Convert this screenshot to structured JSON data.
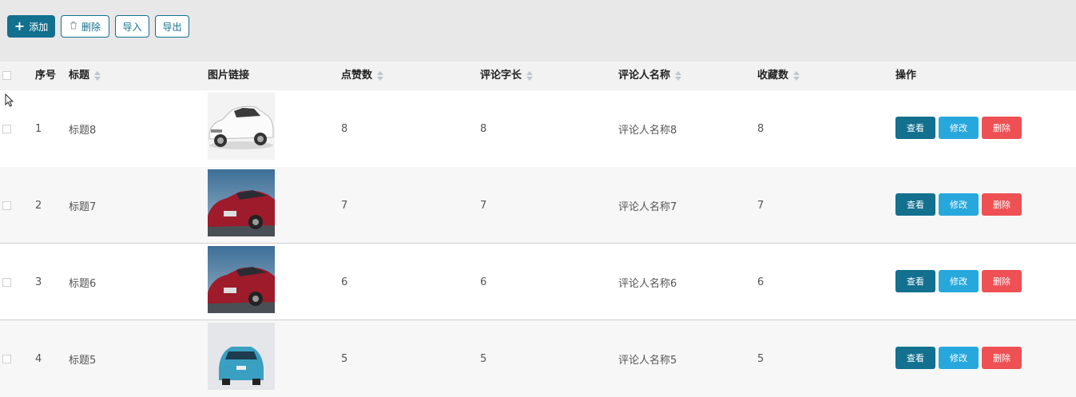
{
  "toolbar": {
    "add_label": "添加",
    "delete_label": "删除",
    "import_label": "导入",
    "export_label": "导出"
  },
  "table": {
    "headers": {
      "index": "序号",
      "title": "标题",
      "image": "图片链接",
      "likes": "点赞数",
      "comment_length": "评论字长",
      "commenter": "评论人名称",
      "favorites": "收藏数",
      "actions": "操作"
    },
    "rows": [
      {
        "index": "1",
        "title": "标题8",
        "likes": "8",
        "comment_length": "8",
        "commenter": "评论人名称8",
        "favorites": "8",
        "image": "white-car"
      },
      {
        "index": "2",
        "title": "标题7",
        "likes": "7",
        "comment_length": "7",
        "commenter": "评论人名称7",
        "favorites": "7",
        "image": "red-car"
      },
      {
        "index": "3",
        "title": "标题6",
        "likes": "6",
        "comment_length": "6",
        "commenter": "评论人名称6",
        "favorites": "6",
        "image": "red-car"
      },
      {
        "index": "4",
        "title": "标题5",
        "likes": "5",
        "comment_length": "5",
        "commenter": "评论人名称5",
        "favorites": "5",
        "image": "blue-car"
      }
    ],
    "row_actions": {
      "view_label": "查看",
      "edit_label": "修改",
      "delete_label": "删除"
    }
  },
  "colors": {
    "primary": "#13708f",
    "edit": "#27a8dc",
    "delete": "#ee5053"
  }
}
